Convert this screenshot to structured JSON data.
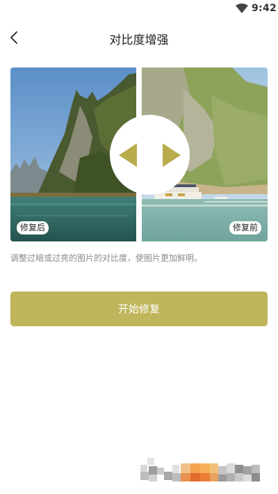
{
  "status_bar": {
    "time": "9:42",
    "icon": "wifi-icon"
  },
  "header": {
    "title": "对比度增强",
    "back_icon": "chevron-left-icon"
  },
  "compare": {
    "after_label": "修复后",
    "before_label": "修复前",
    "knob_icons": [
      "triangle-left-icon",
      "triangle-right-icon"
    ]
  },
  "description": "调整过暗或过亮的图片的对比度，使图片更加鲜明。",
  "start_button": {
    "label": "开始修复"
  },
  "colors": {
    "accent": "#bfb55a",
    "arrow": "#b8ac4c",
    "muted_text": "#8a8a8a",
    "label_bg": "#ffffff"
  }
}
